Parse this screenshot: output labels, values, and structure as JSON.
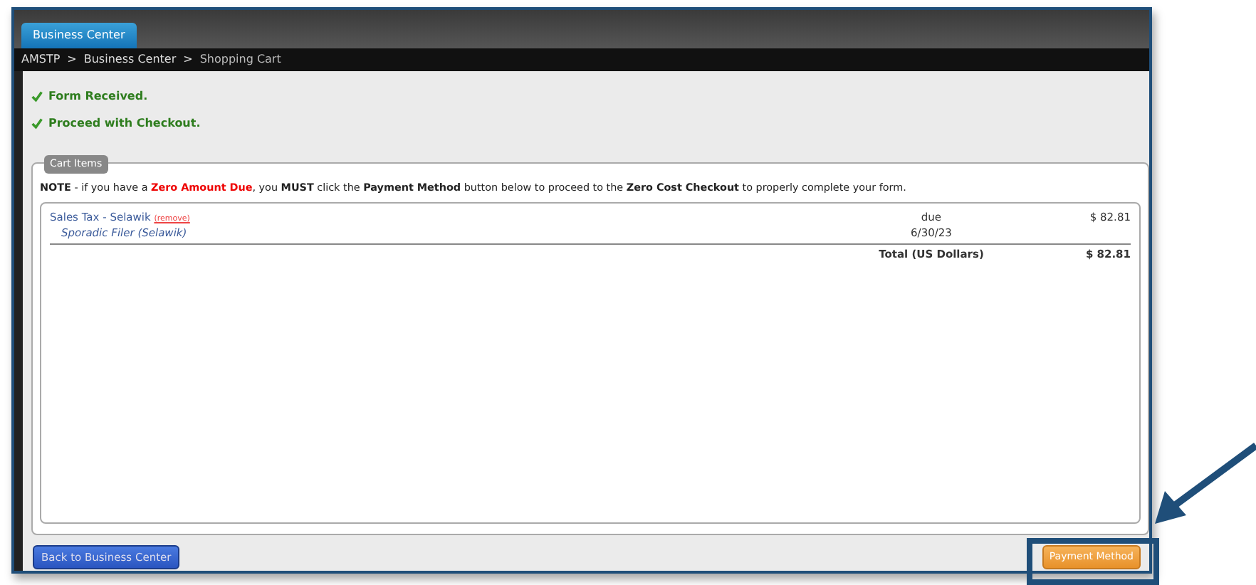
{
  "tab": {
    "label": "Business Center",
    "selected": true
  },
  "breadcrumb": {
    "separator": ">",
    "items": [
      "AMSTP",
      "Business Center",
      "Shopping Cart"
    ]
  },
  "messages": [
    "Form Received.",
    "Proceed with Checkout."
  ],
  "cart": {
    "legend": "Cart Items",
    "note": [
      {
        "kind": "bold",
        "text": "NOTE"
      },
      {
        "kind": "plain",
        "text": " - if you have a "
      },
      {
        "kind": "alert",
        "text": "Zero Amount Due"
      },
      {
        "kind": "plain",
        "text": ", you "
      },
      {
        "kind": "bold",
        "text": "MUST"
      },
      {
        "kind": "plain",
        "text": " click the "
      },
      {
        "kind": "bold",
        "text": "Payment Method"
      },
      {
        "kind": "plain",
        "text": " button below to proceed to the "
      },
      {
        "kind": "bold",
        "text": "Zero Cost Checkout"
      },
      {
        "kind": "plain",
        "text": " to properly complete your form."
      }
    ],
    "items": [
      {
        "name": "Sales Tax - Selawik",
        "remove": "(remove)",
        "subtitle": "Sporadic Filer (Selawik)",
        "due_label": "due",
        "due_date": "6/30/23",
        "amount": "$ 82.81"
      }
    ],
    "total_label": "Total (US Dollars)",
    "total": "$ 82.81"
  },
  "buttons": [
    {
      "kind": "back",
      "label": "Back to Business Center"
    },
    {
      "kind": "pay",
      "label": "Payment Method"
    }
  ]
}
